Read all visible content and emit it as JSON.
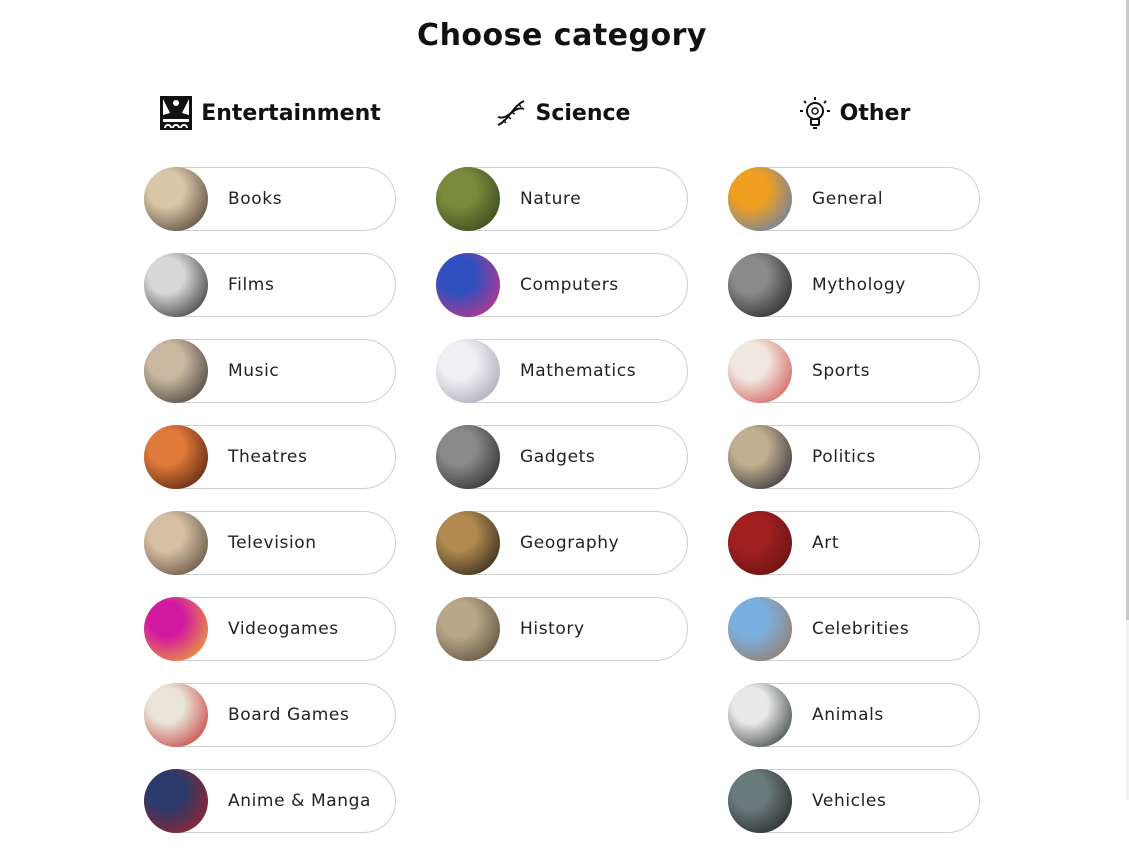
{
  "title": "Choose category",
  "columns": [
    {
      "key": "entertainment",
      "title": "Entertainment",
      "icon": "theatre-icon",
      "items": [
        {
          "label": "Books",
          "thumb": [
            "#d9c7a8",
            "#3a2d20"
          ]
        },
        {
          "label": "Films",
          "thumb": [
            "#d8d8d8",
            "#1a1a1a"
          ]
        },
        {
          "label": "Music",
          "thumb": [
            "#c9b8a0",
            "#2e2a26"
          ]
        },
        {
          "label": "Theatres",
          "thumb": [
            "#e07a3a",
            "#3a120a"
          ]
        },
        {
          "label": "Television",
          "thumb": [
            "#d6bfa4",
            "#4a3a2a"
          ]
        },
        {
          "label": "Videogames",
          "thumb": [
            "#d21aa0",
            "#f0c020"
          ]
        },
        {
          "label": "Board Games",
          "thumb": [
            "#e9e4d8",
            "#c02020"
          ]
        },
        {
          "label": "Anime & Manga",
          "thumb": [
            "#2a3a6a",
            "#b02020"
          ]
        }
      ]
    },
    {
      "key": "science",
      "title": "Science",
      "icon": "dna-icon",
      "items": [
        {
          "label": "Nature",
          "thumb": [
            "#7a8a3a",
            "#2a3a1a"
          ]
        },
        {
          "label": "Computers",
          "thumb": [
            "#3050c0",
            "#e0307a"
          ]
        },
        {
          "label": "Mathematics",
          "thumb": [
            "#f0f0f4",
            "#9a9aa6"
          ]
        },
        {
          "label": "Gadgets",
          "thumb": [
            "#8a8a8a",
            "#1a1a1a"
          ]
        },
        {
          "label": "Geography",
          "thumb": [
            "#b08a50",
            "#1a1410"
          ]
        },
        {
          "label": "History",
          "thumb": [
            "#b8a888",
            "#4a3e2e"
          ]
        }
      ]
    },
    {
      "key": "other",
      "title": "Other",
      "icon": "lightbulb-icon",
      "items": [
        {
          "label": "General",
          "thumb": [
            "#f0a020",
            "#4a7ac8"
          ]
        },
        {
          "label": "Mythology",
          "thumb": [
            "#8a8a8a",
            "#141414"
          ]
        },
        {
          "label": "Sports",
          "thumb": [
            "#f0e8e0",
            "#d04040"
          ]
        },
        {
          "label": "Politics",
          "thumb": [
            "#c0b090",
            "#1a1a2a"
          ]
        },
        {
          "label": "Art",
          "thumb": [
            "#a02020",
            "#5a1010"
          ]
        },
        {
          "label": "Celebrities",
          "thumb": [
            "#7ab0e0",
            "#a07050"
          ]
        },
        {
          "label": "Animals",
          "thumb": [
            "#e8e8e8",
            "#1a2420"
          ]
        },
        {
          "label": "Vehicles",
          "thumb": [
            "#6a7a7a",
            "#1a1a1a"
          ]
        }
      ]
    }
  ]
}
